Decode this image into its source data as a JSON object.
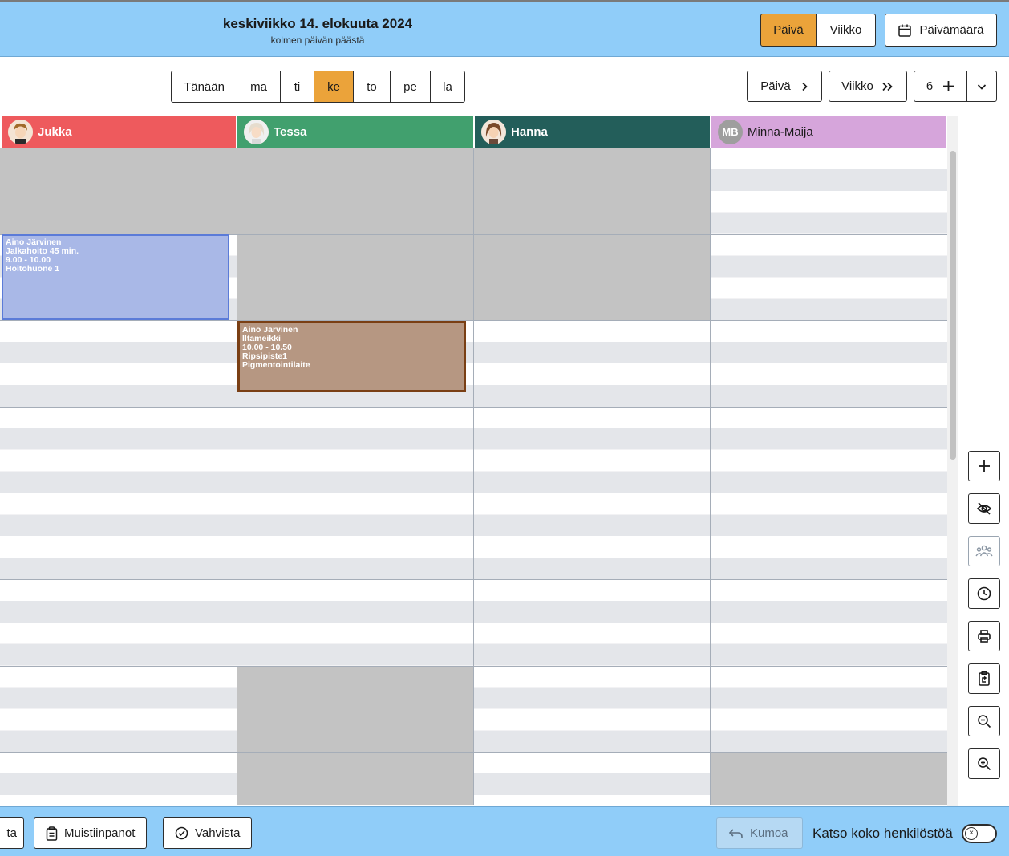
{
  "header": {
    "date_title": "keskiviikko 14. elokuuta 2024",
    "date_subtitle": "kolmen päivän päästä",
    "view_day": "Päivä",
    "view_week": "Viikko",
    "date_picker": "Päivämäärä"
  },
  "toolbar": {
    "today": "Tänään",
    "days": [
      "ma",
      "ti",
      "ke",
      "to",
      "pe",
      "la"
    ],
    "active_day": "ke",
    "next_day": "Päivä",
    "next_week": "Viikko",
    "count": "6"
  },
  "staff": [
    {
      "name": "Jukka",
      "color": "#ee5a5d",
      "avatar": "illustrated"
    },
    {
      "name": "Tessa",
      "color": "#41a06e",
      "avatar": "illustrated"
    },
    {
      "name": "Hanna",
      "color": "#235e5a",
      "avatar": "illustrated"
    },
    {
      "name": "Minna-Maija",
      "color": "#d6a5db",
      "avatar": "MB"
    }
  ],
  "events": [
    {
      "staff": "Jukka",
      "lines": [
        "Aino Järvinen",
        "Jalkahoito 45 min.",
        "9.00 - 10.00",
        "Hoitohuone 1"
      ],
      "fill": "#a9b8e7",
      "border": "#5b7bd8"
    },
    {
      "staff": "Tessa",
      "lines": [
        "Aino Järvinen",
        "Iltameikki",
        "10.00 - 10.50",
        "Ripsipiste1",
        "Pigmentointilaite"
      ],
      "fill": "#b69782",
      "border": "#7a3f14"
    }
  ],
  "side_tools": [
    "plus-icon",
    "eye-off-icon",
    "group-icon",
    "clock-icon",
    "printer-icon",
    "clipboard-copy-icon",
    "zoom-out-icon",
    "zoom-in-icon"
  ],
  "footer": {
    "partial_label": "ta",
    "notes": "Muistiinpanot",
    "confirm": "Vahvista",
    "undo": "Kumoa",
    "all_staff_label": "Katso koko henkilöstöä",
    "all_staff_on": false
  },
  "colors": {
    "header_bg": "#90cdf9",
    "accent": "#eba33a",
    "unavailable": "#c3c3c3"
  }
}
